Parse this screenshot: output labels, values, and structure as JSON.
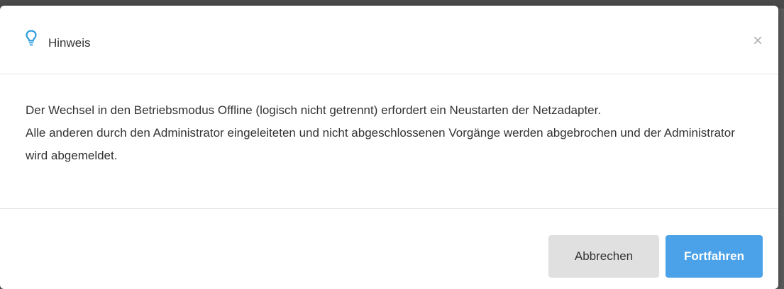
{
  "dialog": {
    "title": "Hinweis",
    "icon": "lightbulb-icon",
    "close_glyph": "×",
    "body": {
      "paragraph1": "Der Wechsel in den Betriebsmodus Offline (logisch nicht getrennt) erfordert ein Neustarten der Netzadapter.",
      "paragraph2": "Alle anderen durch den Administrator eingeleiteten und nicht abgeschlossenen Vorgänge werden abgebrochen und der Administrator wird abgemeldet."
    },
    "buttons": {
      "cancel_label": "Abbrechen",
      "confirm_label": "Fortfahren"
    }
  },
  "colors": {
    "accent": "#4ba2e8",
    "icon": "#2f9ee0",
    "cancel_bg": "#e0e0e0",
    "text": "#333333"
  }
}
